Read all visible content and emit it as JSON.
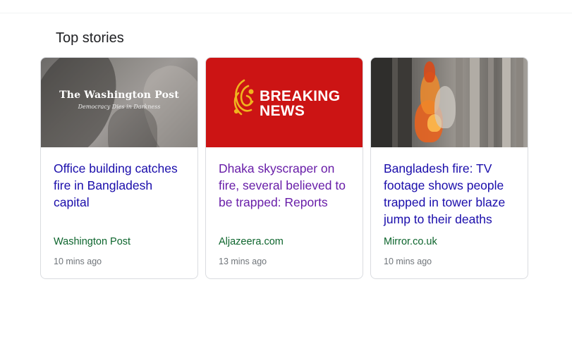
{
  "section": {
    "title": "Top stories"
  },
  "stories": [
    {
      "thumbnail": {
        "logo_text": "The Washington Post",
        "tagline": "Democracy Dies in Darkness"
      },
      "headline": "Office building catches fire in Bangladesh capital",
      "source": "Washington Post",
      "time": "10 mins ago",
      "visited": false
    },
    {
      "thumbnail": {
        "line1": "BREAKING",
        "line2": "NEWS"
      },
      "headline": "Dhaka skyscraper on fire, several believed to be trapped: Reports",
      "source": "Aljazeera.com",
      "time": "13 mins ago",
      "visited": true
    },
    {
      "thumbnail": {
        "description": "fire-photo"
      },
      "headline": "Bangladesh fire: TV footage shows people trapped in tower blaze jump to their deaths",
      "source": "Mirror.co.uk",
      "time": "10 mins ago",
      "visited": false
    }
  ],
  "colors": {
    "link": "#1a0dab",
    "visited_link": "#681da8",
    "source": "#0d652d",
    "time": "#70757a",
    "breaking_red": "#cc1414"
  }
}
